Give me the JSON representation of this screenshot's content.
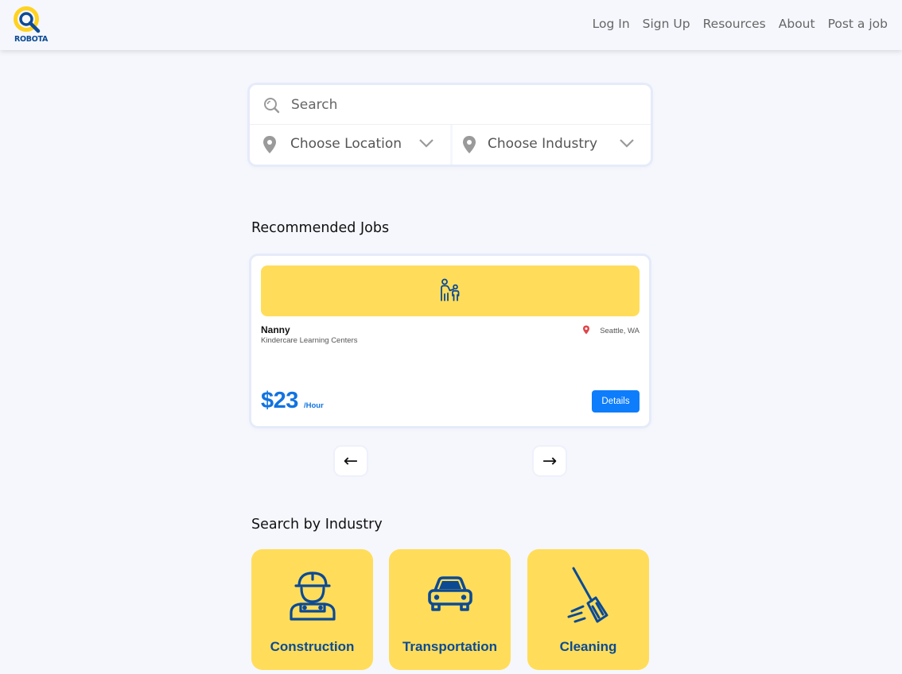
{
  "header": {
    "logo_text": "ROBOTA",
    "nav": [
      "Log In",
      "Sign Up",
      "Resources",
      "About",
      "Post a job"
    ]
  },
  "search": {
    "placeholder": "Search",
    "location_label": "Choose Location",
    "industry_label": "Choose Industry"
  },
  "recommended": {
    "title": "Recommended Jobs",
    "job": {
      "icon": "parent-child-icon",
      "title": "Nanny",
      "company": "Kindercare Learning Centers",
      "location": "Seattle, WA",
      "pay": "$23",
      "pay_unit": "/Hour",
      "details_label": "Details"
    },
    "prev_label": "←",
    "next_label": "→"
  },
  "industries": {
    "title": "Search by Industry",
    "items": [
      {
        "label": "Construction",
        "icon": "construction-worker-icon"
      },
      {
        "label": "Transportation",
        "icon": "car-icon"
      },
      {
        "label": "Cleaning",
        "icon": "broom-icon"
      }
    ]
  },
  "colors": {
    "background": "#f5f7fd",
    "accent_yellow": "#ffdd5a",
    "brand_blue": "#0c4a94",
    "primary_blue": "#0d7dfc",
    "pin_red": "#e0454b"
  }
}
